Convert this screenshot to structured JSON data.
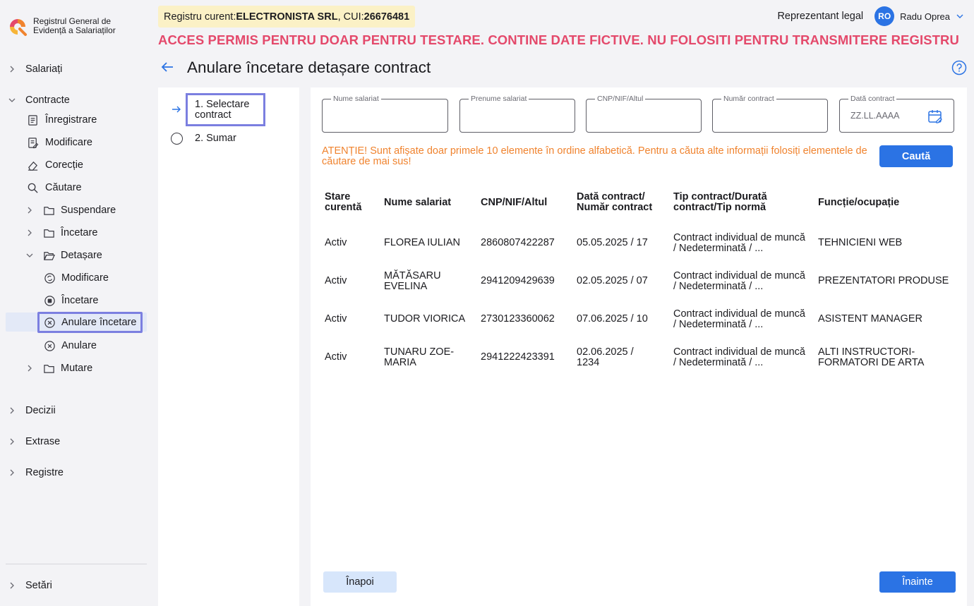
{
  "app": {
    "name": "Registrul General de Evidență a Salariaților",
    "registry_prefix": "Registru curent: ",
    "company": "ELECTRONISTA SRL",
    "cui_prefix": ", CUI: ",
    "cui": "26676481",
    "test_warning": "ACCES PERMIS PENTRU DOAR PENTRU TESTARE. CONTINE DATE FICTIVE. NU FOLOSITI PENTRU TRANSMITERE REGISTRU"
  },
  "user": {
    "role": "Reprezentant legal",
    "initials": "RO",
    "name": "Radu Oprea"
  },
  "sidebar": {
    "salariati": "Salariați",
    "contracte": "Contracte",
    "inregistrare": "Înregistrare",
    "modificare": "Modificare",
    "corectie": "Corecție",
    "cautare": "Căutare",
    "suspendare": "Suspendare",
    "incetare": "Încetare",
    "detasare": "Detașare",
    "det_modificare": "Modificare",
    "det_incetare": "Încetare",
    "det_anulare_incetare": "Anulare încetare",
    "det_anulare": "Anulare",
    "mutare": "Mutare",
    "decizii": "Decizii",
    "extrase": "Extrase",
    "registre": "Registre",
    "setari": "Setări"
  },
  "page": {
    "title": "Anulare încetare detașare contract"
  },
  "steps": {
    "step1": "1. Selectare contract",
    "step2": "2. Sumar"
  },
  "filters": {
    "nume_label": "Nume salariat",
    "prenume_label": "Prenume salariat",
    "cnp_label": "CNP/NIF/Altul",
    "numar_label": "Număr contract",
    "data_label": "Dată contract",
    "data_placeholder": "ZZ.LL.AAAA"
  },
  "notice": "ATENȚIE! Sunt afișate doar primele 10 elemente în ordine alfabetică. Pentru a căuta alte informații folosiți elementele de căutare de mai sus!",
  "search_button": "Caută",
  "table": {
    "headers": {
      "stare": "Stare curentă",
      "nume": "Nume salariat",
      "cnp": "CNP/NIF/Altul",
      "data": "Dată contract/ Număr contract",
      "tip": "Tip contract/Durată contract/Tip normă",
      "functie": "Funcție/ocupație"
    },
    "rows": [
      {
        "stare": "Activ",
        "nume": "FLOREA IULIAN",
        "cnp": "2860807422287",
        "data": "05.05.2025 / 17",
        "tip": "Contract individual de muncă / Nedeterminată / ...",
        "functie": "TEHNICIENI WEB"
      },
      {
        "stare": "Activ",
        "nume": "MĂTĂSARU EVELINA",
        "cnp": "2941209429639",
        "data": "02.05.2025 / 07",
        "tip": "Contract individual de muncă / Nedeterminată / ...",
        "functie": "PREZENTATORI PRODUSE"
      },
      {
        "stare": "Activ",
        "nume": "TUDOR VIORICA",
        "cnp": "2730123360062",
        "data": "07.06.2025 / 10",
        "tip": "Contract individual de muncă / Nedeterminată / ...",
        "functie": "ASISTENT MANAGER"
      },
      {
        "stare": "Activ",
        "nume": "TUNARU ZOE-MARIA",
        "cnp": "2941222423391",
        "data": "02.06.2025 / 1234",
        "tip": "Contract individual de muncă / Nedeterminată / ...",
        "functie": "ALTI INSTRUCTORI-FORMATORI DE ARTA"
      }
    ]
  },
  "footer": {
    "prev": "Înapoi",
    "next": "Înainte"
  },
  "colors": {
    "accent": "#2b73e4",
    "warning": "#e4496b",
    "notice": "#f0832e",
    "focus": "#7b7fe0"
  }
}
